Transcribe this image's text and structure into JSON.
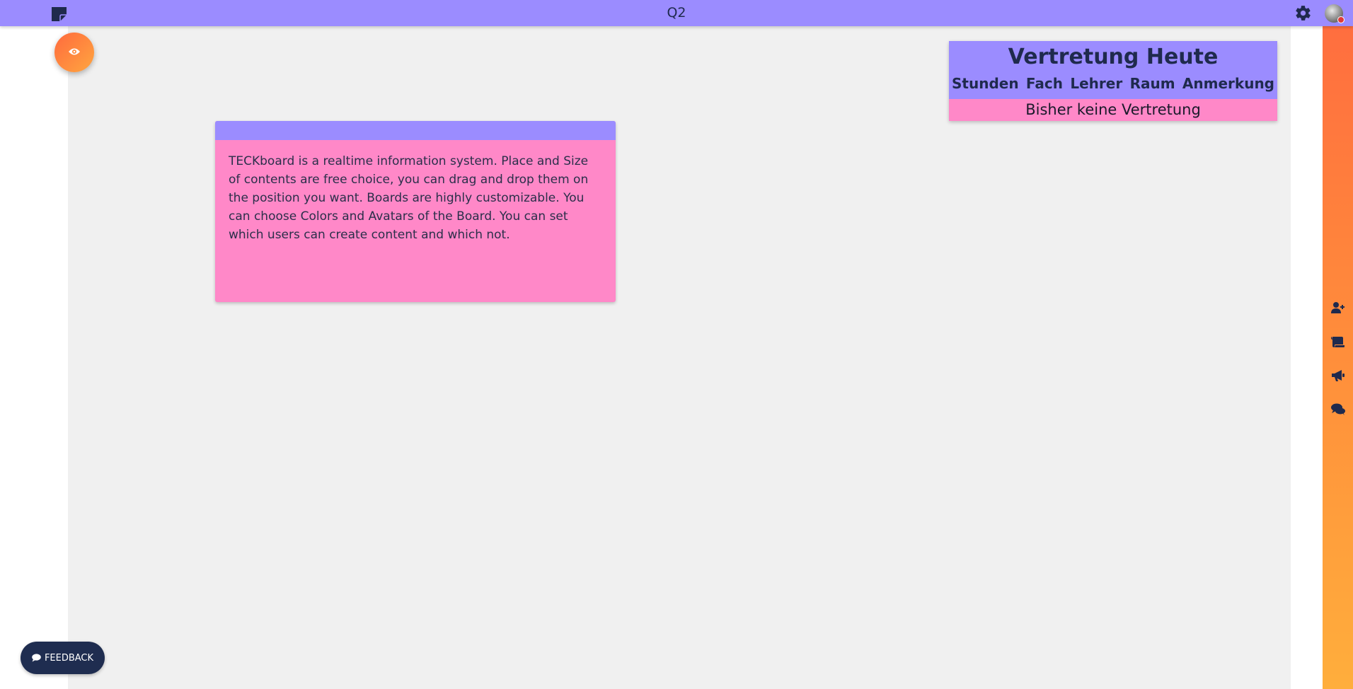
{
  "header": {
    "board_title": "Q2"
  },
  "text_card": {
    "content": "TECKboard is a realtime information system. Place and Size of contents are free choice, you can drag and drop them on the position you want. Boards are highly customizable. You can choose Colors and Avatars of the Board. You can set which users can create content and which not."
  },
  "substitution": {
    "title": "Vertretung Heute",
    "columns": [
      "Stunden",
      "Fach",
      "Lehrer",
      "Raum",
      "Anmerkung"
    ],
    "empty_message": "Bisher keine Vertretung"
  },
  "sidebar_icons": [
    "add-user-icon",
    "scroll-icon",
    "megaphone-icon",
    "comments-icon"
  ],
  "feedback": {
    "label": "FEEDBACK"
  },
  "colors": {
    "primary": "#9b8cff",
    "card_pink": "#ff88c8",
    "accent_orange": "#ff6e3f",
    "accent_yellow": "#ffae3c",
    "navy": "#1f2d50",
    "canvas": "#f0f0f0"
  }
}
